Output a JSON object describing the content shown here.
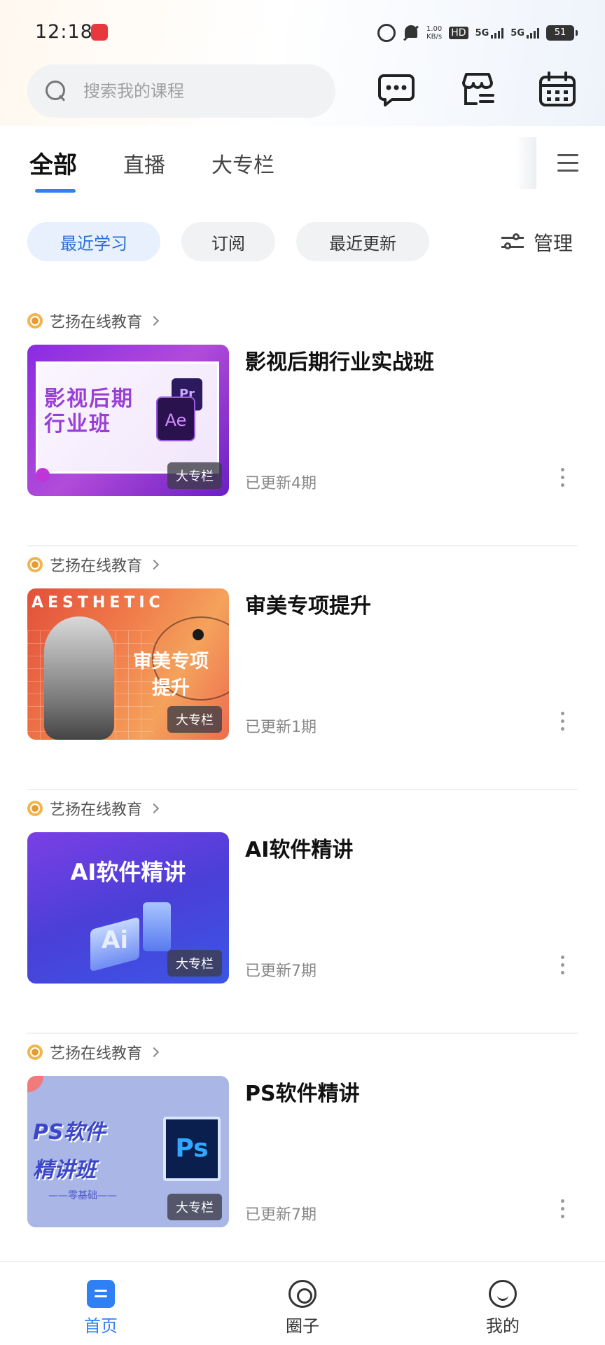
{
  "status_bar": {
    "time": "12:18",
    "net_speed_value": "1.00",
    "net_speed_unit": "KB/s",
    "hd_label": "HD",
    "network_1": "5G",
    "network_2": "5G",
    "battery": "51"
  },
  "search": {
    "placeholder": "搜索我的课程"
  },
  "tabs": [
    {
      "label": "全部",
      "active": true
    },
    {
      "label": "直播",
      "active": false
    },
    {
      "label": "大专栏",
      "active": false
    }
  ],
  "filters": [
    {
      "label": "最近学习",
      "active": true
    },
    {
      "label": "订阅",
      "active": false
    },
    {
      "label": "最近更新",
      "active": false
    }
  ],
  "manage_label": "管理",
  "courses": [
    {
      "publisher": "艺扬在线教育",
      "title": "影视后期行业实战班",
      "badge": "大专栏",
      "update": "已更新4期",
      "thumb_text_1": "影视后期",
      "thumb_text_2": "行业班",
      "thumb_pr": "Pr",
      "thumb_ae": "Ae"
    },
    {
      "publisher": "艺扬在线教育",
      "title": "审美专项提升",
      "badge": "大专栏",
      "update": "已更新1期",
      "thumb_text_1": "审美专项",
      "thumb_text_2": "提升",
      "thumb_top": "AESTHETIC"
    },
    {
      "publisher": "艺扬在线教育",
      "title": "AI软件精讲",
      "badge": "大专栏",
      "update": "已更新7期",
      "thumb_text_1": "AI软件精讲",
      "thumb_ai": "Ai"
    },
    {
      "publisher": "艺扬在线教育",
      "title": "PS软件精讲",
      "badge": "大专栏",
      "update": "已更新7期",
      "thumb_text_1": "PS软件",
      "thumb_text_2": "精讲班",
      "thumb_sub": "——零基础——",
      "thumb_ps": "Ps"
    }
  ],
  "bottom_nav": [
    {
      "label": "首页",
      "icon": "home-icon",
      "active": true
    },
    {
      "label": "圈子",
      "icon": "circle-icon",
      "active": false
    },
    {
      "label": "我的",
      "icon": "me-icon",
      "active": false
    }
  ],
  "colors": {
    "accent": "#2f7ff5",
    "chip_active_bg": "#e7f0fc",
    "chip_active_text": "#2a6fd6"
  }
}
